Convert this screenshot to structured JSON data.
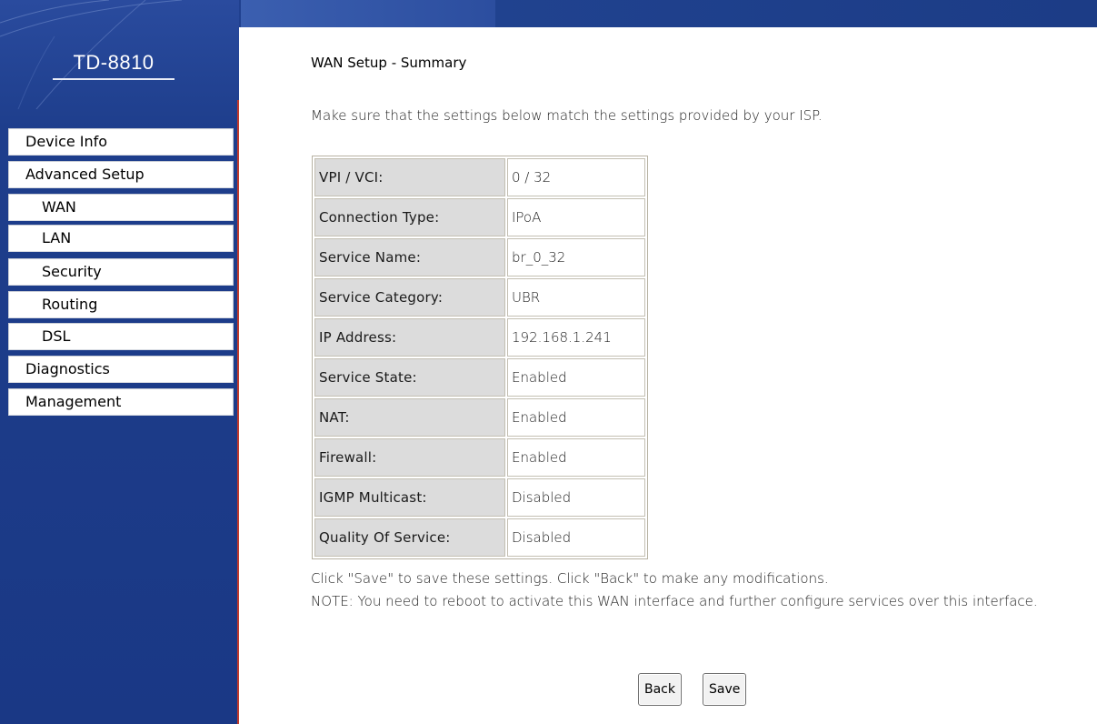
{
  "brand": {
    "model": "TD-8810"
  },
  "nav": {
    "items": [
      {
        "label": "Device Info",
        "level": "top"
      },
      {
        "label": "Advanced Setup",
        "level": "top"
      },
      {
        "label": "WAN",
        "level": "sub"
      },
      {
        "label": "LAN",
        "level": "sub"
      },
      {
        "label": "Security",
        "level": "sub"
      },
      {
        "label": "Routing",
        "level": "sub"
      },
      {
        "label": "DSL",
        "level": "sub"
      },
      {
        "label": "Diagnostics",
        "level": "top"
      },
      {
        "label": "Management",
        "level": "top"
      }
    ]
  },
  "main": {
    "title": "WAN Setup - Summary",
    "intro": "Make sure that the settings below match the settings provided by your ISP.",
    "summary": [
      {
        "label": "VPI / VCI:",
        "value": "0 / 32"
      },
      {
        "label": "Connection Type:",
        "value": "IPoA"
      },
      {
        "label": "Service Name:",
        "value": "br_0_32"
      },
      {
        "label": "Service Category:",
        "value": "UBR"
      },
      {
        "label": "IP Address:",
        "value": "192.168.1.241"
      },
      {
        "label": "Service State:",
        "value": "Enabled"
      },
      {
        "label": "NAT:",
        "value": "Enabled"
      },
      {
        "label": "Firewall:",
        "value": "Enabled"
      },
      {
        "label": "IGMP Multicast:",
        "value": "Disabled"
      },
      {
        "label": "Quality Of Service:",
        "value": "Disabled"
      }
    ],
    "note_line1": "Click \"Save\" to save these settings. Click \"Back\" to make any modifications.",
    "note_line2": "NOTE: You need to reboot to activate this WAN interface and further configure services over this interface.",
    "back_label": "Back",
    "save_label": "Save"
  },
  "colors": {
    "sidebar": "#1e3e8c",
    "sidebar_edge": "#c23a2c",
    "label_cell": "#dcdcdc"
  }
}
